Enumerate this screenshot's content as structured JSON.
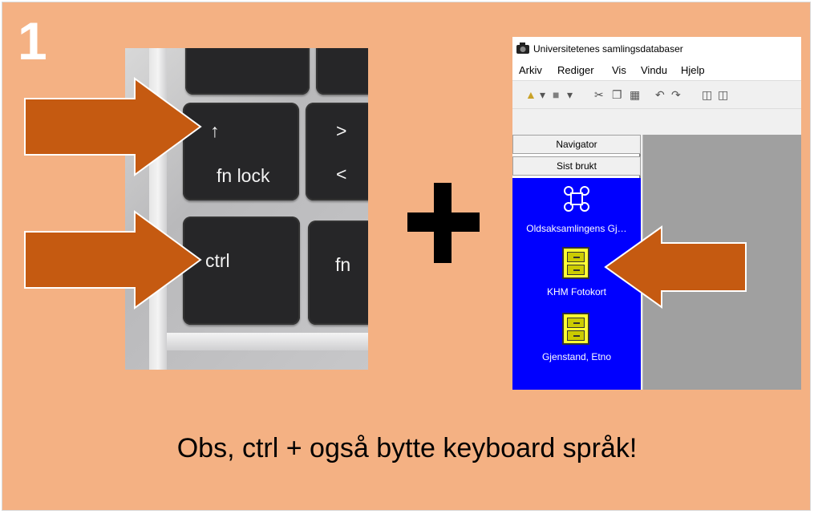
{
  "step_number": "1",
  "keyboard": {
    "up_key_arrow": "↑",
    "up_key_label": "fn lock",
    "gt_label": ">",
    "lt_label": "<",
    "ctrl_label": "ctrl",
    "fn_label": "fn"
  },
  "app": {
    "title": "Universitetenes samlingsdatabaser",
    "menu": [
      "Arkiv",
      "Rediger",
      "Vis",
      "Vindu",
      "Hjelp"
    ],
    "nav_tabs": [
      "Navigator",
      "Sist brukt"
    ],
    "shortcuts": [
      "Oldsaksamlingens Gj…",
      "KHM Fotokort",
      "Gjenstand, Etno"
    ],
    "colors": {
      "panel": "#0000ff",
      "cabinet": "#ffff33"
    }
  },
  "caption": "Obs, ctrl +  også bytte keyboard språk!",
  "colors": {
    "background": "#f4b183",
    "arrow": "#c55a11"
  }
}
